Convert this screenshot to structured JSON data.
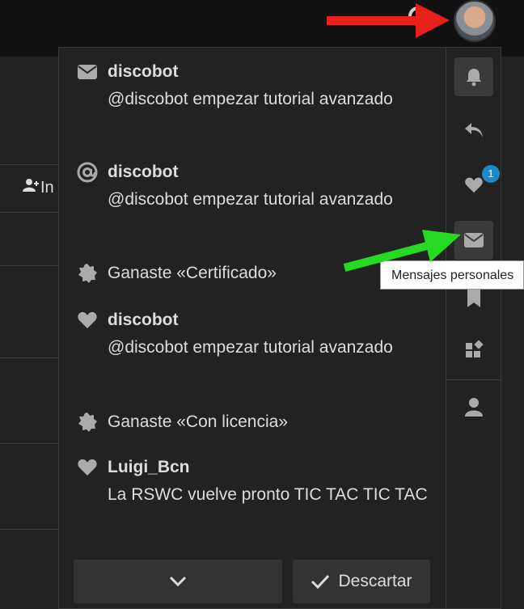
{
  "header": {
    "avatar_alt": "user avatar"
  },
  "background": {
    "invite_label": "In"
  },
  "notifications": [
    {
      "icon": "envelope-icon",
      "user": "discobot",
      "text": "@discobot empezar tutorial avanzado"
    },
    {
      "icon": "at-icon",
      "user": "discobot",
      "text": "@discobot empezar tutorial avanzado"
    },
    {
      "icon": "badge-icon",
      "user": "",
      "text": "Ganaste «Certificado»"
    },
    {
      "icon": "heart-icon",
      "user": "discobot",
      "text": "@discobot empezar tutorial avanzado"
    },
    {
      "icon": "badge-icon",
      "user": "",
      "text": "Ganaste «Con licencia»"
    },
    {
      "icon": "heart-icon",
      "user": "Luigi_Bcn",
      "text": "La RSWC vuelve pronto TIC TAC TIC TAC"
    }
  ],
  "sidebar_tabs": [
    {
      "icon": "bell-icon",
      "name": "notifications"
    },
    {
      "icon": "reply-icon",
      "name": "replies"
    },
    {
      "icon": "heart-icon",
      "name": "likes",
      "badge": "1"
    },
    {
      "icon": "envelope-icon",
      "name": "messages"
    },
    {
      "icon": "bookmark-icon",
      "name": "bookmarks"
    },
    {
      "icon": "review-icon",
      "name": "review"
    },
    {
      "icon": "user-icon",
      "name": "profile"
    }
  ],
  "footer": {
    "show_more_icon": "chevron-down-icon",
    "dismiss_label": "Descartar"
  },
  "tooltip": {
    "text": "Mensajes personales"
  },
  "colors": {
    "accent": "#1e88c8",
    "arrow_red": "#e8201a",
    "arrow_green": "#26d921"
  }
}
